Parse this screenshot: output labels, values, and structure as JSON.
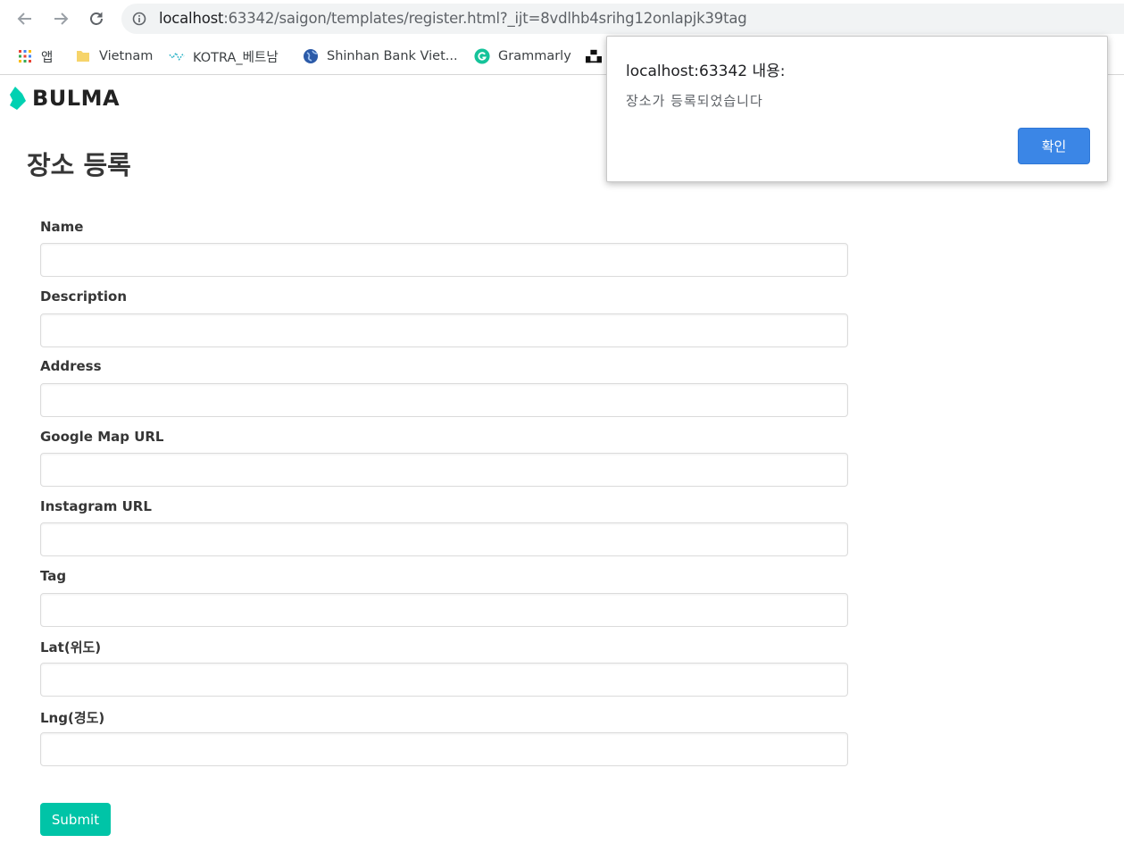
{
  "browser": {
    "url_host": "localhost",
    "url_rest": ":63342/saigon/templates/register.html?_ijt=8vdlhb4srihg12onlapjk39tag",
    "bookmarks": [
      {
        "label": "앱",
        "icon": "apps-grid-icon"
      },
      {
        "label": "Vietnam",
        "icon": "folder-icon"
      },
      {
        "label": "KOTRA_베트남",
        "icon": "kotra-icon"
      },
      {
        "label": "Shinhan Bank Viet...",
        "icon": "globe-icon"
      },
      {
        "label": "Grammarly",
        "icon": "grammarly-icon"
      },
      {
        "label": "",
        "icon": "unsplash-icon"
      }
    ]
  },
  "brand": {
    "name": "BULMA",
    "color": "#00d1b2"
  },
  "page": {
    "title": "장소 등록"
  },
  "form": {
    "fields": [
      {
        "label": "Name",
        "value": ""
      },
      {
        "label": "Description",
        "value": ""
      },
      {
        "label": "Address",
        "value": ""
      },
      {
        "label": "Google Map URL",
        "value": ""
      },
      {
        "label": "Instagram URL",
        "value": ""
      },
      {
        "label": "Tag",
        "value": ""
      },
      {
        "label": "Lat(위도)",
        "value": ""
      },
      {
        "label": "Lng(경도)",
        "value": ""
      }
    ],
    "submit_label": "Submit",
    "submit_color": "#00c4a7"
  },
  "dialog": {
    "title": "localhost:63342 내용:",
    "message": "장소가 등록되었습니다",
    "ok_label": "확인",
    "ok_color": "#3b86e6"
  }
}
